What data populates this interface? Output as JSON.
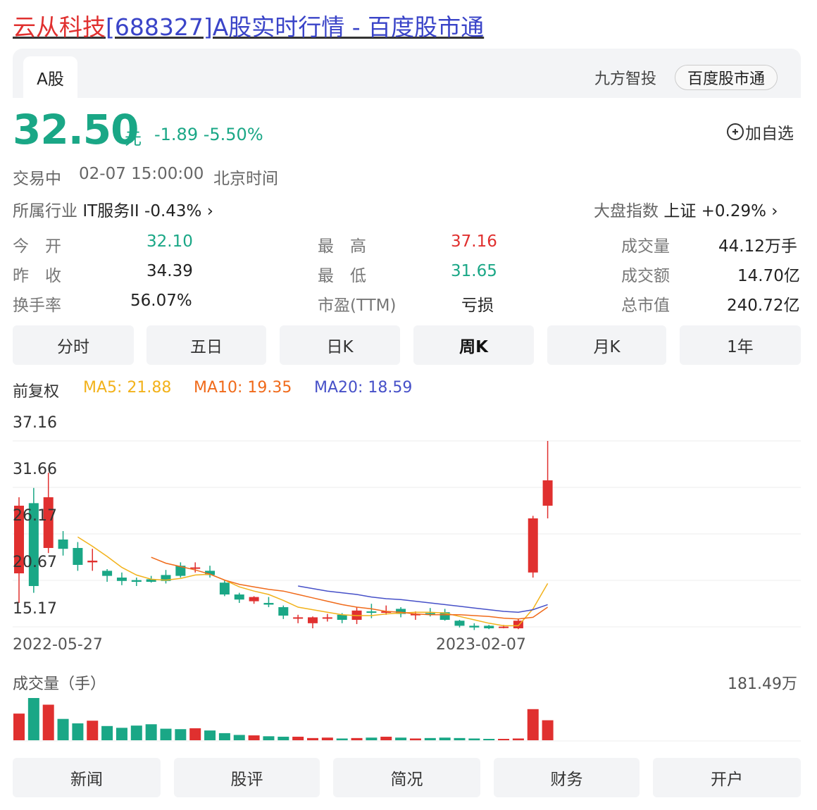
{
  "page_title": {
    "name": "云从科技",
    "rest": "[688327]A股实时行情 - 百度股市通"
  },
  "market_tab": "A股",
  "sources": [
    "九方智投",
    "百度股市通"
  ],
  "quote": {
    "price": "32.50",
    "unit": "元",
    "change": "-1.89 -5.50%",
    "add_fav": "加自选"
  },
  "status": {
    "state": "交易中",
    "time": "02-07 15:00:00",
    "zone": "北京时间"
  },
  "industry": {
    "label": "所属行业",
    "value": "IT服务II -0.43% ›"
  },
  "index": {
    "label": "大盘指数",
    "value": "上证 +0.29% ›"
  },
  "stats": [
    {
      "label": "今　开",
      "value": "32.10",
      "color": "#1aa786"
    },
    {
      "label": "昨　收",
      "value": "34.39",
      "color": "#222222"
    },
    {
      "label": "换手率",
      "value": "56.07%",
      "color": "#222222"
    },
    {
      "label": "最　高",
      "value": "37.16",
      "color": "#e0302f"
    },
    {
      "label": "最　低",
      "value": "31.65",
      "color": "#1aa786"
    },
    {
      "label": "市盈(TTM)",
      "value": "亏损",
      "color": "#222222"
    },
    {
      "label": "成交量",
      "value": "44.12万手",
      "color": "#222222"
    },
    {
      "label": "成交额",
      "value": "14.70亿",
      "color": "#222222"
    },
    {
      "label": "总市值",
      "value": "240.72亿",
      "color": "#222222"
    }
  ],
  "kline_tabs": [
    "分时",
    "五日",
    "日K",
    "周K",
    "月K",
    "1年"
  ],
  "active_kline_tab": "周K",
  "adjust_label": "前复权",
  "ma": {
    "ma5": "MA5: 21.88",
    "ma10": "MA10: 19.35",
    "ma20": "MA20: 18.59",
    "ma5_color": "#f2b21b",
    "ma10_color": "#f06a1a",
    "ma20_color": "#4650c8"
  },
  "y_labels": [
    "37.16",
    "31.66",
    "26.17",
    "20.67",
    "15.17"
  ],
  "x_labels": [
    "2022-05-27",
    "2023-02-07"
  ],
  "volume": {
    "label": "成交量（手）",
    "max": "181.49万"
  },
  "bottom_tabs": [
    "新闻",
    "股评",
    "简况",
    "财务",
    "开户"
  ],
  "colors": {
    "up": "#e0302f",
    "down": "#1aa786"
  },
  "chart_data": {
    "type": "candlestick",
    "ylim": [
      15.17,
      37.16
    ],
    "candles": [
      [
        21.5,
        29.5,
        18.0,
        30.5
      ],
      [
        29.8,
        20.0,
        19.2,
        31.6
      ],
      [
        24.5,
        30.5,
        23.9,
        33.4
      ],
      [
        25.5,
        24.4,
        23.6,
        26.5
      ],
      [
        24.5,
        22.5,
        21.8,
        25.2
      ],
      [
        22.8,
        23.0,
        21.8,
        24.4
      ],
      [
        21.8,
        21.2,
        20.5,
        22.0
      ],
      [
        21.0,
        20.6,
        20.1,
        21.6
      ],
      [
        20.7,
        20.5,
        20.0,
        21.0
      ],
      [
        20.8,
        20.5,
        20.4,
        21.2
      ],
      [
        21.3,
        20.6,
        20.3,
        21.9
      ],
      [
        22.4,
        21.2,
        21.0,
        22.8
      ],
      [
        22.1,
        22.2,
        21.6,
        22.8
      ],
      [
        21.8,
        21.3,
        21.0,
        22.4
      ],
      [
        20.4,
        19.0,
        18.8,
        20.7
      ],
      [
        19.0,
        18.4,
        18.0,
        19.2
      ],
      [
        18.2,
        18.7,
        17.9,
        18.8
      ],
      [
        18.0,
        17.8,
        17.5,
        18.7
      ],
      [
        17.5,
        16.5,
        16.1,
        17.7
      ],
      [
        16.2,
        16.3,
        15.6,
        16.6
      ],
      [
        15.6,
        16.3,
        15.0,
        16.4
      ],
      [
        16.2,
        16.3,
        15.8,
        16.7
      ],
      [
        16.6,
        16.0,
        15.6,
        16.8
      ],
      [
        16.0,
        17.1,
        15.5,
        17.5
      ],
      [
        17.0,
        16.9,
        16.2,
        17.9
      ],
      [
        16.9,
        17.0,
        16.6,
        17.7
      ],
      [
        17.3,
        16.7,
        16.3,
        17.5
      ],
      [
        16.6,
        16.7,
        16.0,
        17.0
      ],
      [
        16.8,
        16.7,
        16.4,
        17.4
      ],
      [
        16.9,
        16.0,
        15.9,
        17.3
      ],
      [
        15.9,
        15.3,
        15.1,
        16.0
      ],
      [
        15.3,
        15.1,
        14.8,
        15.6
      ],
      [
        15.3,
        15.0,
        14.9,
        15.4
      ],
      [
        15.1,
        15.2,
        15.0,
        15.4
      ],
      [
        15.0,
        15.9,
        14.9,
        16.1
      ],
      [
        21.6,
        28.0,
        21.0,
        28.3
      ],
      [
        29.5,
        32.5,
        28.0,
        37.16
      ]
    ],
    "ma5": [
      null,
      null,
      null,
      null,
      25.8,
      24.7,
      23.5,
      22.2,
      21.3,
      20.8,
      20.7,
      20.9,
      21.3,
      21.4,
      20.7,
      19.9,
      19.4,
      19.0,
      18.3,
      17.5,
      17.2,
      16.9,
      16.6,
      16.5,
      16.5,
      16.7,
      16.8,
      16.9,
      16.9,
      16.8,
      16.4,
      16.0,
      15.6,
      15.3,
      15.3,
      17.3,
      20.3
    ],
    "ma10": [
      null,
      null,
      null,
      null,
      null,
      null,
      null,
      null,
      null,
      23.4,
      22.7,
      22.3,
      21.9,
      21.4,
      20.7,
      20.2,
      19.9,
      19.6,
      19.4,
      19.0,
      18.6,
      18.2,
      17.8,
      17.5,
      17.3,
      17.0,
      16.9,
      16.7,
      16.6,
      16.6,
      16.6,
      16.5,
      16.4,
      16.2,
      16.1,
      16.3,
      17.5
    ],
    "ma20": [
      null,
      null,
      null,
      null,
      null,
      null,
      null,
      null,
      null,
      null,
      null,
      null,
      null,
      null,
      null,
      null,
      null,
      null,
      null,
      20.0,
      19.7,
      19.4,
      19.2,
      19.0,
      18.7,
      18.5,
      18.4,
      18.2,
      18.0,
      17.8,
      17.6,
      17.4,
      17.2,
      17.0,
      16.9,
      17.2,
      17.8
    ],
    "volume": [
      60,
      95,
      80,
      48,
      38,
      44,
      32,
      28,
      33,
      36,
      26,
      25,
      27,
      22,
      16,
      12,
      11,
      9,
      8,
      8,
      5,
      6,
      4,
      5,
      6,
      8,
      6,
      4,
      5,
      6,
      5,
      4,
      3,
      3,
      4,
      70,
      45
    ],
    "volume_max": "181.49万"
  }
}
